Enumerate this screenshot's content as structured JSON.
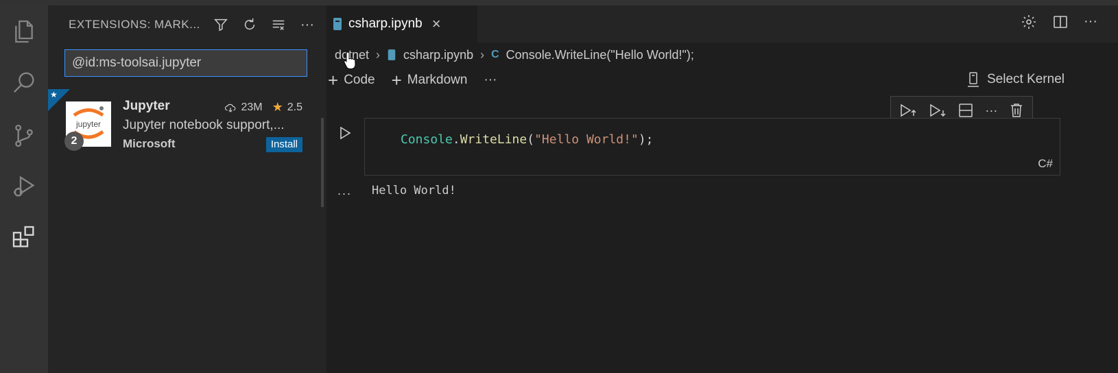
{
  "colors": {
    "accent": "#0e639c",
    "focus": "#3794ff",
    "star": "#f1a93b",
    "code_class": "#4ec9b0",
    "code_method": "#dcdcaa",
    "code_string": "#ce9178"
  },
  "activity_bar": {
    "icons": [
      "explorer-icon",
      "search-icon",
      "source-control-icon",
      "run-debug-icon",
      "extensions-icon"
    ]
  },
  "sidebar": {
    "title": "EXTENSIONS: MARK...",
    "search_value": "@id:ms-toolsai.jupyter",
    "extension": {
      "logo_text": "jupyter",
      "badge": "2",
      "name": "Jupyter",
      "downloads": "23M",
      "rating": "2.5",
      "description": "Jupyter notebook support,...",
      "publisher": "Microsoft",
      "install_label": "Install"
    }
  },
  "editor": {
    "tab_label": "csharp.ipynb",
    "tab_close": "×",
    "breadcrumbs": {
      "folder": "dotnet",
      "file": "csharp.ipynb",
      "symbol": "Console.WriteLine(\"Hello World!\");"
    },
    "toolbar": {
      "code_label": "Code",
      "markdown_label": "Markdown",
      "more": "···",
      "kernel_label": "Select Kernel"
    },
    "cell": {
      "code": {
        "class": "Console",
        "dot": ".",
        "method": "WriteLine",
        "open": "(",
        "string": "\"Hello World!\"",
        "close": ");"
      },
      "language": "C#"
    },
    "output": {
      "dots": "...",
      "text": "Hello World!"
    }
  }
}
